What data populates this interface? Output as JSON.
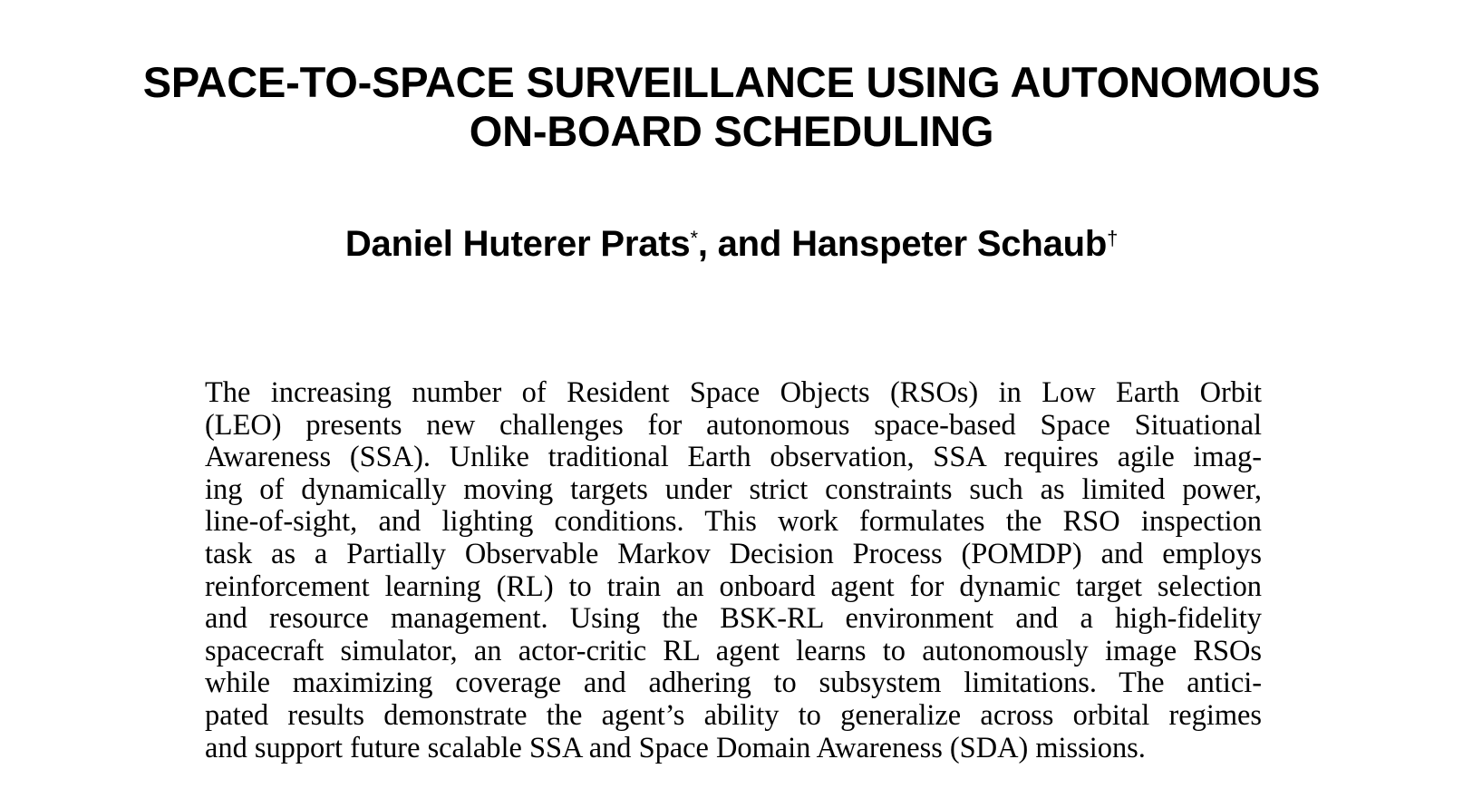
{
  "paper": {
    "title_lines": [
      "SPACE-TO-SPACE SURVEILLANCE USING AUTONOMOUS",
      "ON-BOARD SCHEDULING"
    ],
    "authors": {
      "author1": "Daniel Huterer Prats",
      "author1_mark": "*",
      "connector": ", and ",
      "author2": "Hanspeter Schaub",
      "author2_mark": "†"
    },
    "abstract_lines": [
      "The increasing number of Resident Space Objects (RSOs) in Low Earth Orbit",
      "(LEO) presents new challenges for autonomous space-based Space Situational",
      "Awareness (SSA). Unlike traditional Earth observation, SSA requires agile imag-",
      "ing of dynamically moving targets under strict constraints such as limited power,",
      "line-of-sight, and lighting conditions.  This work formulates the RSO inspection",
      "task as a Partially Observable Markov Decision Process (POMDP) and employs",
      "reinforcement learning (RL) to train an onboard agent for dynamic target selection",
      "and resource management.  Using the BSK-RL environment and a high-fidelity",
      "spacecraft simulator, an actor-critic RL agent learns to autonomously image RSOs",
      "while maximizing coverage and adhering to subsystem limitations.  The antici-",
      "pated results demonstrate the agent’s ability to generalize across orbital regimes",
      "and support future scalable SSA and Space Domain Awareness (SDA) missions."
    ]
  }
}
